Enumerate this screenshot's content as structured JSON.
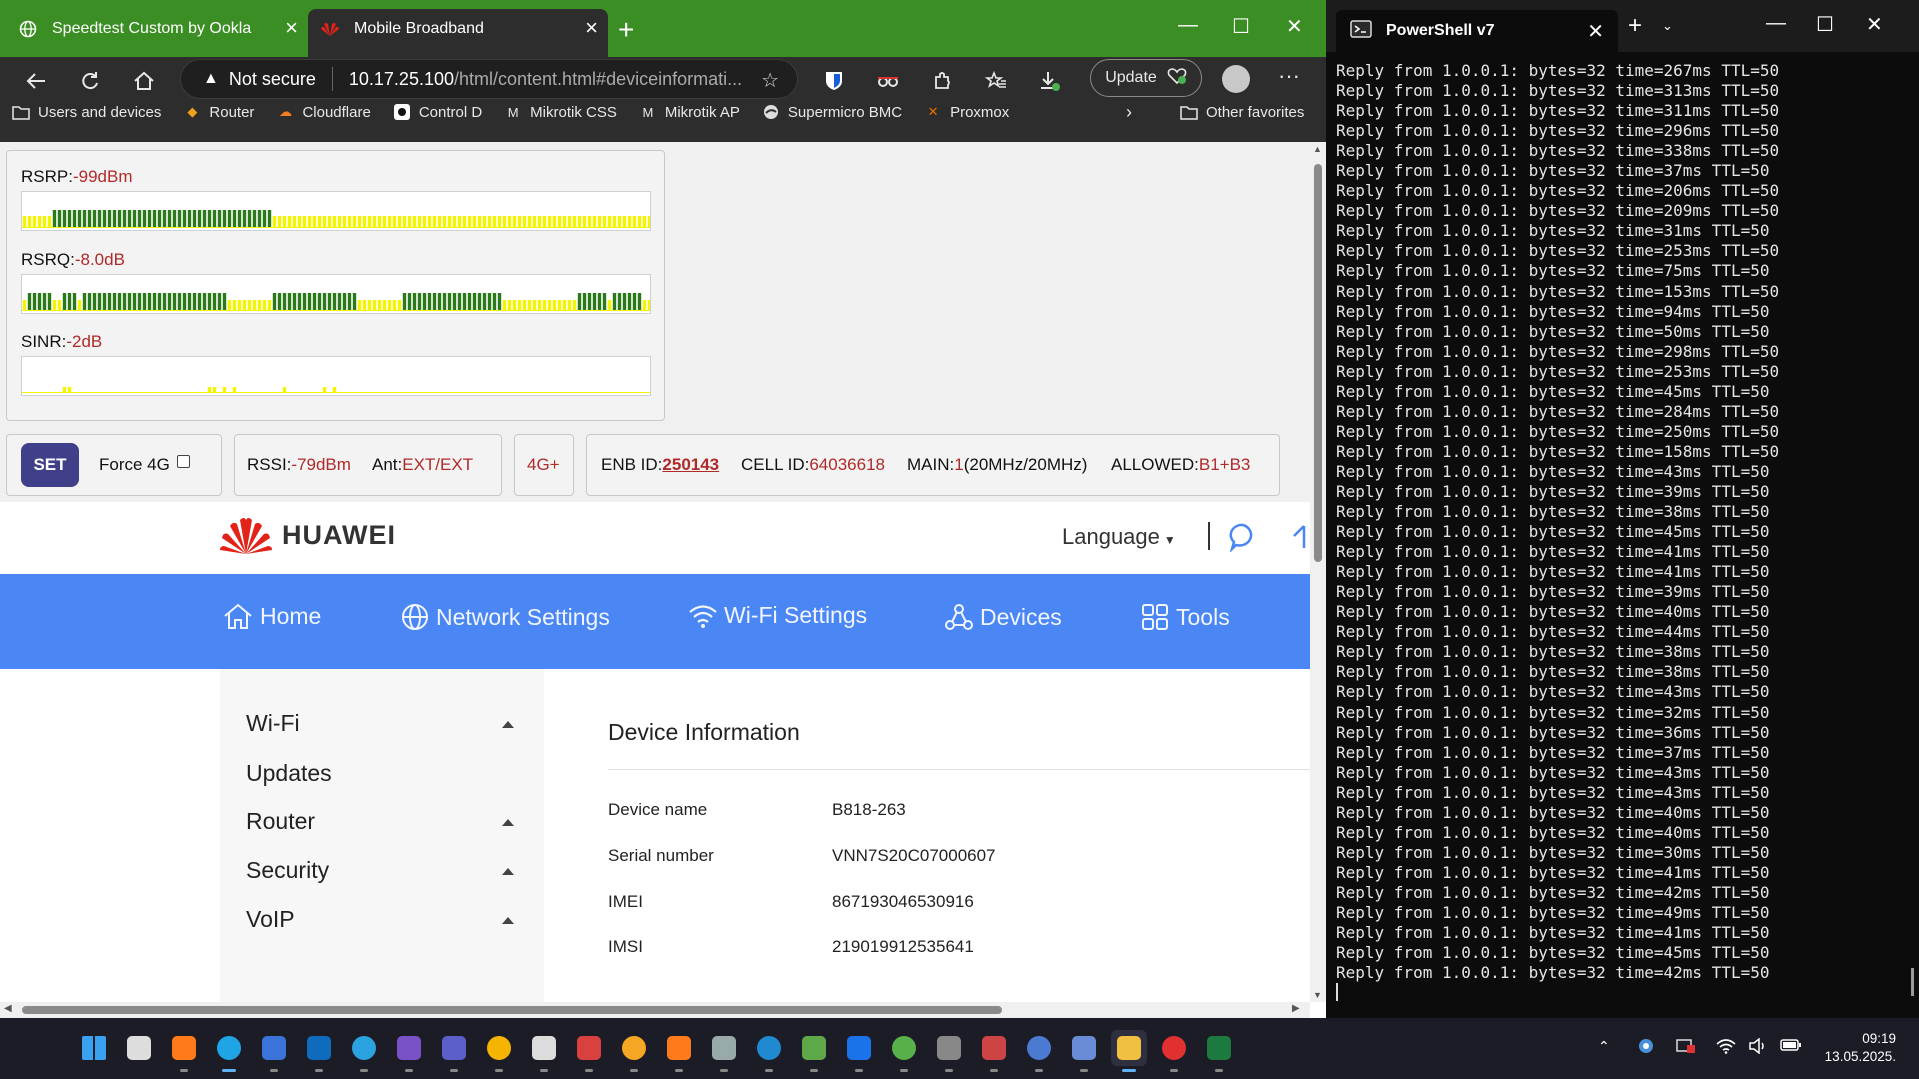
{
  "browser": {
    "tabs": [
      {
        "title": "Speedtest Custom by Ookla",
        "icon": "globe-icon"
      },
      {
        "title": "Mobile Broadband",
        "icon": "huawei-icon"
      }
    ],
    "address": {
      "security": "Not secure",
      "host": "10.17.25.100",
      "path": "/html/content.html#deviceinformati..."
    },
    "update_label": "Update",
    "bookmarks": [
      {
        "label": "Users and devices",
        "icon": "folder-icon"
      },
      {
        "label": "Router",
        "icon": "router-icon"
      },
      {
        "label": "Cloudflare",
        "icon": "cloudflare-icon"
      },
      {
        "label": "Control D",
        "icon": "controld-icon"
      },
      {
        "label": "Mikrotik CSS",
        "icon": "mikrotik-icon"
      },
      {
        "label": "Mikrotik AP",
        "icon": "mikrotik-icon"
      },
      {
        "label": "Supermicro BMC",
        "icon": "supermicro-icon"
      },
      {
        "label": "Proxmox",
        "icon": "proxmox-icon"
      }
    ],
    "other_favorites": "Other favorites"
  },
  "signal": {
    "rsrp_label": "RSRP:",
    "rsrp_value": "-99dBm",
    "rsrq_label": "RSRQ:",
    "rsrq_value": "-8.0dB",
    "sinr_label": "SINR:",
    "sinr_value": "-2dB"
  },
  "controls": {
    "set_label": "SET",
    "force4g_label": "Force 4G",
    "force4g_checked": false,
    "rssi_label": "RSSI:",
    "rssi_value": "-79dBm",
    "ant_label": "Ant:",
    "ant_value": "EXT/EXT",
    "mode": "4G+",
    "enb_label": "ENB ID:",
    "enb_value": "250143",
    "cell_label": "CELL ID:",
    "cell_value": "64036618",
    "main_label": "MAIN:",
    "main_value": "1",
    "main_extra": "(20MHz/20MHz)",
    "allowed_label": "ALLOWED:",
    "allowed_value": "B1+B3"
  },
  "huawei": {
    "logo_text": "HUAWEI",
    "language": "Language",
    "nav": [
      {
        "label": "Home",
        "icon": "home-icon"
      },
      {
        "label": "Network Settings",
        "icon": "globe-icon"
      },
      {
        "label": "Wi-Fi Settings",
        "icon": "wifi-icon"
      },
      {
        "label": "Devices",
        "icon": "devices-icon"
      },
      {
        "label": "Tools",
        "icon": "tools-icon"
      }
    ],
    "sidebar": [
      {
        "label": "Wi-Fi",
        "expandable": true
      },
      {
        "label": "Updates",
        "expandable": false
      },
      {
        "label": "Router",
        "expandable": true
      },
      {
        "label": "Security",
        "expandable": true
      },
      {
        "label": "VoIP",
        "expandable": true
      }
    ],
    "section_title": "Device Information",
    "info": [
      {
        "key": "Device name",
        "value": "B818-263"
      },
      {
        "key": "Serial number",
        "value": "VNN7S20C07000607"
      },
      {
        "key": "IMEI",
        "value": "867193046530916"
      },
      {
        "key": "IMSI",
        "value": "219019912535641"
      }
    ]
  },
  "powershell": {
    "title": "PowerShell v7",
    "lines": [
      "Reply from 1.0.0.1: bytes=32 time=267ms TTL=50",
      "Reply from 1.0.0.1: bytes=32 time=313ms TTL=50",
      "Reply from 1.0.0.1: bytes=32 time=311ms TTL=50",
      "Reply from 1.0.0.1: bytes=32 time=296ms TTL=50",
      "Reply from 1.0.0.1: bytes=32 time=338ms TTL=50",
      "Reply from 1.0.0.1: bytes=32 time=37ms TTL=50",
      "Reply from 1.0.0.1: bytes=32 time=206ms TTL=50",
      "Reply from 1.0.0.1: bytes=32 time=209ms TTL=50",
      "Reply from 1.0.0.1: bytes=32 time=31ms TTL=50",
      "Reply from 1.0.0.1: bytes=32 time=253ms TTL=50",
      "Reply from 1.0.0.1: bytes=32 time=75ms TTL=50",
      "Reply from 1.0.0.1: bytes=32 time=153ms TTL=50",
      "Reply from 1.0.0.1: bytes=32 time=94ms TTL=50",
      "Reply from 1.0.0.1: bytes=32 time=50ms TTL=50",
      "Reply from 1.0.0.1: bytes=32 time=298ms TTL=50",
      "Reply from 1.0.0.1: bytes=32 time=253ms TTL=50",
      "Reply from 1.0.0.1: bytes=32 time=45ms TTL=50",
      "Reply from 1.0.0.1: bytes=32 time=284ms TTL=50",
      "Reply from 1.0.0.1: bytes=32 time=250ms TTL=50",
      "Reply from 1.0.0.1: bytes=32 time=158ms TTL=50",
      "Reply from 1.0.0.1: bytes=32 time=43ms TTL=50",
      "Reply from 1.0.0.1: bytes=32 time=39ms TTL=50",
      "Reply from 1.0.0.1: bytes=32 time=38ms TTL=50",
      "Reply from 1.0.0.1: bytes=32 time=45ms TTL=50",
      "Reply from 1.0.0.1: bytes=32 time=41ms TTL=50",
      "Reply from 1.0.0.1: bytes=32 time=41ms TTL=50",
      "Reply from 1.0.0.1: bytes=32 time=39ms TTL=50",
      "Reply from 1.0.0.1: bytes=32 time=40ms TTL=50",
      "Reply from 1.0.0.1: bytes=32 time=44ms TTL=50",
      "Reply from 1.0.0.1: bytes=32 time=38ms TTL=50",
      "Reply from 1.0.0.1: bytes=32 time=38ms TTL=50",
      "Reply from 1.0.0.1: bytes=32 time=43ms TTL=50",
      "Reply from 1.0.0.1: bytes=32 time=32ms TTL=50",
      "Reply from 1.0.0.1: bytes=32 time=36ms TTL=50",
      "Reply from 1.0.0.1: bytes=32 time=37ms TTL=50",
      "Reply from 1.0.0.1: bytes=32 time=43ms TTL=50",
      "Reply from 1.0.0.1: bytes=32 time=43ms TTL=50",
      "Reply from 1.0.0.1: bytes=32 time=40ms TTL=50",
      "Reply from 1.0.0.1: bytes=32 time=40ms TTL=50",
      "Reply from 1.0.0.1: bytes=32 time=30ms TTL=50",
      "Reply from 1.0.0.1: bytes=32 time=41ms TTL=50",
      "Reply from 1.0.0.1: bytes=32 time=42ms TTL=50",
      "Reply from 1.0.0.1: bytes=32 time=49ms TTL=50",
      "Reply from 1.0.0.1: bytes=32 time=41ms TTL=50",
      "Reply from 1.0.0.1: bytes=32 time=45ms TTL=50",
      "Reply from 1.0.0.1: bytes=32 time=42ms TTL=50"
    ]
  },
  "taskbar": {
    "apps": [
      "start-icon",
      "search-icon",
      "firefox-icon",
      "edge-icon",
      "thunderbird-icon",
      "outlook-icon",
      "telegram-icon",
      "viber-icon",
      "teams-icon",
      "weather-icon",
      "fox-icon",
      "remote-app-icon",
      "chart-app-icon",
      "firefox-alt-icon",
      "calculator-icon",
      "vscode-icon",
      "image-app-icon",
      "browser-icon",
      "winbox-icon",
      "terminal-icon",
      "mremote-icon",
      "disk-icon",
      "network-app-icon",
      "explorer-icon",
      "acrobat-icon",
      "excel-icon"
    ],
    "time": "09:19",
    "date": "13.05.2025."
  },
  "colors": {
    "browser_tab_green": "#3a8e23",
    "huawei_nav_blue": "#4b86f5",
    "signal_good": "#2b7a1a",
    "signal_weak": "#f5f500",
    "value_red": "#b02a2a",
    "set_button": "#3f3f8a"
  }
}
